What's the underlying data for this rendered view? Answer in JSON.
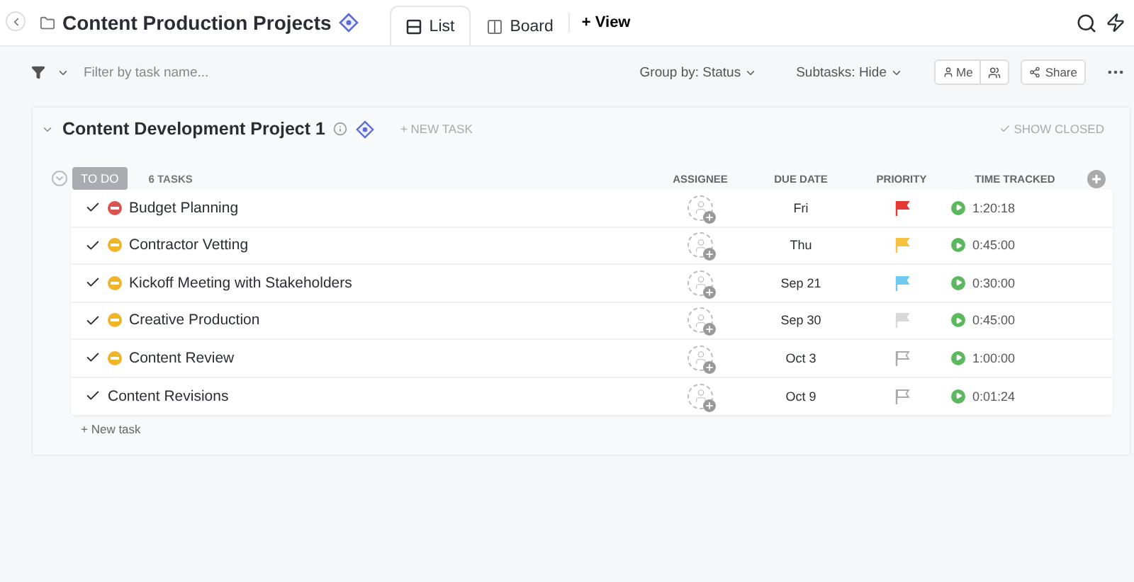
{
  "header": {
    "title": "Content Production Projects",
    "views": [
      {
        "label": "List",
        "kind": "list",
        "selected": true
      },
      {
        "label": "Board",
        "kind": "board",
        "selected": false
      }
    ],
    "add_view": "+ View"
  },
  "toolbar": {
    "filter_placeholder": "Filter by task name...",
    "group_by": "Group by: Status",
    "subtasks": "Subtasks: Hide",
    "me": "Me",
    "share": "Share"
  },
  "list": {
    "title": "Content Development Project 1",
    "new_task": "+ NEW TASK",
    "show_closed": "SHOW CLOSED",
    "status": "TO DO",
    "count": "6 TASKS",
    "columns": [
      "ASSIGNEE",
      "DUE DATE",
      "PRIORITY",
      "TIME TRACKED"
    ],
    "tasks": [
      {
        "name": "Budget Planning",
        "color": "#d9534f",
        "due": "Fri",
        "flag": {
          "color": "#e53935",
          "filled": true
        },
        "time": "1:20:18"
      },
      {
        "name": "Contractor Vetting",
        "color": "#f0b429",
        "due": "Thu",
        "flag": {
          "color": "#f5c242",
          "filled": true
        },
        "time": "0:45:00"
      },
      {
        "name": "Kickoff Meeting with Stakeholders",
        "color": "#f0b429",
        "due": "Sep 21",
        "flag": {
          "color": "#6fc8f0",
          "filled": true
        },
        "time": "0:30:00"
      },
      {
        "name": "Creative Production",
        "color": "#f0b429",
        "due": "Sep 30",
        "flag": {
          "color": "#d8d8d8",
          "filled": true
        },
        "time": "0:45:00"
      },
      {
        "name": "Content Review",
        "color": "#f0b429",
        "due": "Oct 3",
        "flag": {
          "color": "#aaaaaa",
          "filled": false
        },
        "time": "1:00:00"
      },
      {
        "name": "Content Revisions",
        "due": "Oct 9",
        "flag": {
          "color": "#aaaaaa",
          "filled": false
        },
        "time": "0:01:24"
      }
    ],
    "add_task": "+ New task"
  }
}
